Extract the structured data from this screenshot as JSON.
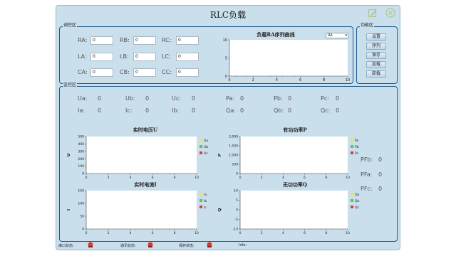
{
  "window": {
    "title": "RLC负载"
  },
  "control_panel": {
    "label": "调控区",
    "fields": [
      {
        "name": "RA:",
        "value": "0"
      },
      {
        "name": "RB:",
        "value": "0"
      },
      {
        "name": "RC:",
        "value": "0"
      },
      {
        "name": "LA:",
        "value": "0"
      },
      {
        "name": "LB:",
        "value": "0"
      },
      {
        "name": "LC:",
        "value": "0"
      },
      {
        "name": "CA:",
        "value": "0"
      },
      {
        "name": "CB:",
        "value": "0"
      },
      {
        "name": "CC:",
        "value": "0"
      }
    ],
    "curve": {
      "title": "负载RA序列曲线",
      "select_value": "RA",
      "x_ticks": [
        "0",
        "2",
        "4",
        "6",
        "8",
        "10"
      ],
      "y_ticks": [
        "0",
        "5",
        "10"
      ]
    }
  },
  "function_panel": {
    "label": "功能区",
    "buttons": [
      "设置",
      "序列",
      "保存",
      "加载",
      "卸载"
    ]
  },
  "monitor_panel": {
    "label": "监控区",
    "voltage_row": [
      {
        "name": "Ua:",
        "value": "0"
      },
      {
        "name": "Ub:",
        "value": "0"
      },
      {
        "name": "Uc:",
        "value": "0"
      },
      {
        "name": "Pa:",
        "value": "0"
      },
      {
        "name": "Pb:",
        "value": "0"
      },
      {
        "name": "Pc:",
        "value": "0"
      }
    ],
    "current_row": [
      {
        "name": "Ia:",
        "value": "0"
      },
      {
        "name": "Ic:",
        "value": "0"
      },
      {
        "name": "Ib:",
        "value": "0"
      },
      {
        "name": "Qa:",
        "value": "0"
      },
      {
        "name": "Qb:",
        "value": "0"
      },
      {
        "name": "Qc:",
        "value": "0"
      }
    ],
    "pf": [
      {
        "name": "PFb:",
        "value": "0"
      },
      {
        "name": "PFa:",
        "value": "0"
      },
      {
        "name": "PFc:",
        "value": "0"
      }
    ]
  },
  "status_bar": {
    "serial": "串口状态:",
    "comm": "通讯状态:",
    "protect": "保护状态:",
    "info": "Info:"
  },
  "colors": {
    "window_bg": "#c9dfec",
    "border": "#1d5a8a",
    "legend_a": "#e8e84a",
    "legend_b": "#5cc65c",
    "legend_c": "#e03c3c",
    "lamp": "#d93a2b"
  },
  "chart_data": [
    {
      "type": "line",
      "title": "负载RA序列曲线",
      "x": [],
      "series": [],
      "xlim": [
        0,
        10
      ],
      "ylim": [
        0,
        10
      ],
      "x_ticks": [
        "0",
        "2",
        "4",
        "6",
        "8",
        "10"
      ],
      "y_ticks": [
        "0",
        "5",
        "10"
      ],
      "ylabel": ""
    },
    {
      "type": "line",
      "title": "实时电压U",
      "ylabel": "U",
      "x": [],
      "series": [
        {
          "name": "Ua",
          "values": []
        },
        {
          "name": "Ub",
          "values": []
        },
        {
          "name": "Uc",
          "values": []
        }
      ],
      "xlim": [
        0,
        10
      ],
      "ylim": [
        0,
        500
      ],
      "x_ticks": [
        "0",
        "2",
        "4",
        "6",
        "8",
        "10"
      ],
      "y_ticks": [
        "0",
        "100",
        "200",
        "300",
        "400",
        "500"
      ]
    },
    {
      "type": "line",
      "title": "有功功率P",
      "ylabel": "P",
      "x": [],
      "series": [
        {
          "name": "Pa",
          "values": []
        },
        {
          "name": "Pb",
          "values": []
        },
        {
          "name": "Pc",
          "values": []
        }
      ],
      "xlim": [
        0,
        10
      ],
      "ylim": [
        0,
        2000
      ],
      "x_ticks": [
        "0",
        "2",
        "4",
        "6",
        "8",
        "10"
      ],
      "y_ticks": [
        "0",
        "500",
        "1,000",
        "1,500",
        "2,000"
      ]
    },
    {
      "type": "line",
      "title": "实时电流I",
      "ylabel": "I",
      "x": [],
      "series": [
        {
          "name": "Ia",
          "values": []
        },
        {
          "name": "Ib",
          "values": []
        },
        {
          "name": "Ic",
          "values": []
        }
      ],
      "xlim": [
        0,
        10
      ],
      "ylim": [
        0,
        150
      ],
      "x_ticks": [
        "0",
        "2",
        "4",
        "6",
        "8",
        "10"
      ],
      "y_ticks": [
        "0",
        "50",
        "100",
        "150"
      ]
    },
    {
      "type": "line",
      "title": "无功功率Q",
      "ylabel": "Q",
      "x": [],
      "series": [
        {
          "name": "Qa",
          "values": []
        },
        {
          "name": "Qb",
          "values": []
        },
        {
          "name": "Qc",
          "values": []
        }
      ],
      "xlim": [
        0,
        10
      ],
      "ylim": [
        -10,
        10
      ],
      "x_ticks": [
        "0",
        "2",
        "4",
        "6",
        "8",
        "10"
      ],
      "y_ticks": [
        "-10",
        "-5",
        "0",
        "5",
        "10"
      ]
    }
  ]
}
